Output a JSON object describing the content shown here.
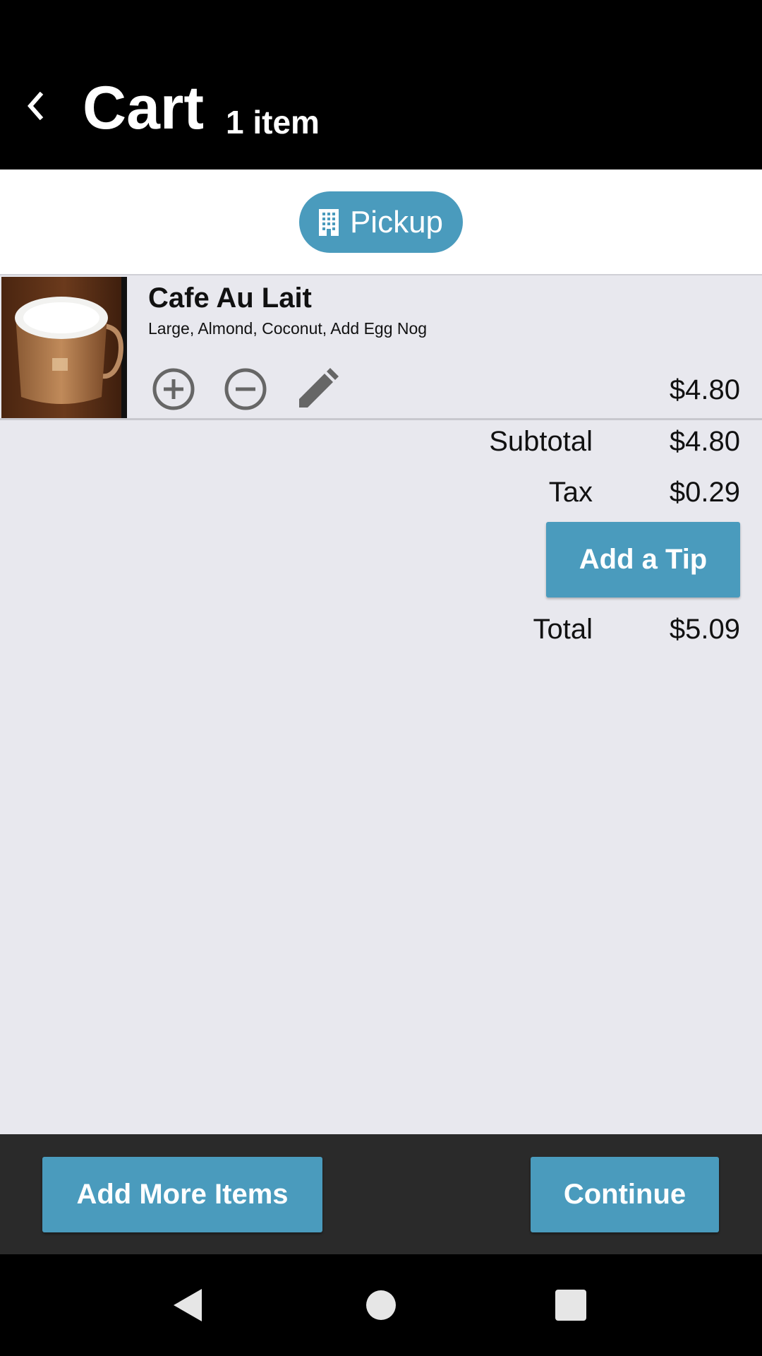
{
  "header": {
    "title": "Cart",
    "item_count": "1 item",
    "back_icon": "chevron-left-icon"
  },
  "order_mode": {
    "label": "Pickup",
    "icon": "building-icon",
    "color": "#4a9bbd"
  },
  "cart": {
    "items": [
      {
        "name": "Cafe Au Lait",
        "options": "Large, Almond, Coconut, Add Egg Nog",
        "price": "$4.80",
        "image": "cafe-au-lait-photo",
        "actions": [
          "plus-circle-icon",
          "minus-circle-icon",
          "pencil-icon"
        ]
      }
    ]
  },
  "totals": {
    "subtotal_label": "Subtotal",
    "subtotal_value": "$4.80",
    "tax_label": "Tax",
    "tax_value": "$0.29",
    "tip_button": "Add a Tip",
    "total_label": "Total",
    "total_value": "$5.09"
  },
  "footer": {
    "add_more_label": "Add More Items",
    "continue_label": "Continue"
  },
  "system_nav": {
    "back_icon": "triangle-back-icon",
    "home_icon": "circle-home-icon",
    "recents_icon": "square-recents-icon"
  },
  "colors": {
    "accent": "#4a9bbd",
    "header_bg": "#000000",
    "content_bg": "#e8e8ee",
    "footer_bg": "#2a2a2a"
  }
}
